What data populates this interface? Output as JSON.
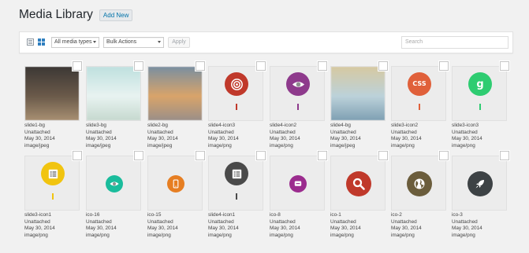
{
  "header": {
    "title": "Media Library",
    "add_new": "Add New"
  },
  "toolbar": {
    "media_type": "All media types",
    "bulk_actions": "Bulk Actions",
    "apply": "Apply",
    "search_placeholder": "Search"
  },
  "items": [
    {
      "name": "slide1-bg",
      "status": "Unattached",
      "date": "May 30, 2014",
      "type": "image/jpeg"
    },
    {
      "name": "slide3-bg",
      "status": "Unattached",
      "date": "May 30, 2014",
      "type": "image/jpeg"
    },
    {
      "name": "slide2-bg",
      "status": "Unattached",
      "date": "May 30, 2014",
      "type": "image/jpeg"
    },
    {
      "name": "slide4-icon3",
      "status": "Unattached",
      "date": "May 30, 2014",
      "type": "image/png"
    },
    {
      "name": "slide4-icon2",
      "status": "Unattached",
      "date": "May 30, 2014",
      "type": "image/png"
    },
    {
      "name": "slide4-bg",
      "status": "Unattached",
      "date": "May 30, 2014",
      "type": "image/jpeg"
    },
    {
      "name": "slide3-icon2",
      "status": "Unattached",
      "date": "May 30, 2014",
      "type": "image/png"
    },
    {
      "name": "slide3-icon3",
      "status": "Unattached",
      "date": "May 30, 2014",
      "type": "image/png"
    },
    {
      "name": "slide3-icon1",
      "status": "Unattached",
      "date": "May 30, 2014",
      "type": "image/png"
    },
    {
      "name": "ico-16",
      "status": "Unattached",
      "date": "May 30, 2014",
      "type": "image/png"
    },
    {
      "name": "ico-15",
      "status": "Unattached",
      "date": "May 30, 2014",
      "type": "image/png"
    },
    {
      "name": "slide4-icon1",
      "status": "Unattached",
      "date": "May 30, 2014",
      "type": "image/png"
    },
    {
      "name": "ico-8",
      "status": "Unattached",
      "date": "May 30, 2014",
      "type": "image/png"
    },
    {
      "name": "ico-1",
      "status": "Unattached",
      "date": "May 30, 2014",
      "type": "image/png"
    },
    {
      "name": "ico-2",
      "status": "Unattached",
      "date": "May 30, 2014",
      "type": "image/png"
    },
    {
      "name": "ico-3",
      "status": "Unattached",
      "date": "May 30, 2014",
      "type": "image/png"
    }
  ],
  "thumbnails": [
    {
      "kind": "photo",
      "colors": [
        "#3c3835",
        "#6b5a4a",
        "#a88f72"
      ]
    },
    {
      "kind": "photo",
      "colors": [
        "#bfe0df",
        "#e8f3f1",
        "#c6d9cf"
      ]
    },
    {
      "kind": "photo",
      "colors": [
        "#7a8fa0",
        "#d9a46a",
        "#9b8f88"
      ]
    },
    {
      "kind": "pin",
      "color": "#c0392b",
      "icon": "target-icon",
      "stem": true
    },
    {
      "kind": "pin",
      "color": "#8e3a8c",
      "icon": "eye-icon",
      "stem": true
    },
    {
      "kind": "photo",
      "colors": [
        "#d6c9a2",
        "#bcd2da",
        "#7fa0b3"
      ]
    },
    {
      "kind": "pin",
      "color": "#e0603a",
      "icon": "css-icon",
      "text": "CSS",
      "stem": true
    },
    {
      "kind": "pin",
      "color": "#2ecc71",
      "icon": "google-icon",
      "text": "g",
      "stem": true
    },
    {
      "kind": "pin",
      "color": "#f1c40f",
      "icon": "list-icon",
      "stem": true
    },
    {
      "kind": "circle",
      "color": "#1abc9c",
      "icon": "eye-icon",
      "size": "small"
    },
    {
      "kind": "circle",
      "color": "#e67e22",
      "icon": "mobile-icon",
      "size": "small"
    },
    {
      "kind": "pin",
      "color": "#4a4a4a",
      "icon": "list-icon",
      "stem": true
    },
    {
      "kind": "circle",
      "color": "#9b2c8e",
      "icon": "chat-icon",
      "size": "small"
    },
    {
      "kind": "circle",
      "color": "#c0392b",
      "icon": "search-icon",
      "size": "large"
    },
    {
      "kind": "circle",
      "color": "#6b5d3c",
      "icon": "globe-icon",
      "size": "large"
    },
    {
      "kind": "circle",
      "color": "#3d4245",
      "icon": "rocket-icon",
      "size": "large"
    }
  ]
}
